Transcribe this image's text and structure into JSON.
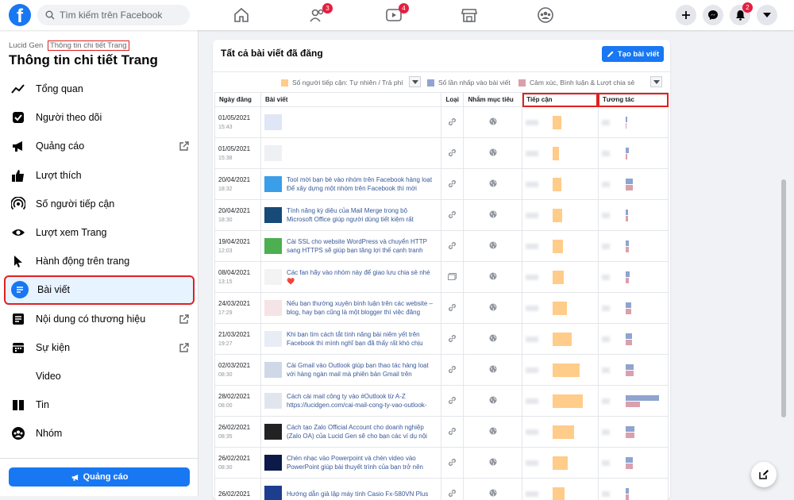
{
  "search": {
    "placeholder": "Tìm kiếm trên Facebook"
  },
  "nav": {
    "friends_badge": "3",
    "watch_badge": "4",
    "notif_badge": "2"
  },
  "sidebar": {
    "page_name": "Lucid Gen",
    "breadcrumb": "Thông tin chi tiết Trang",
    "title": "Thông tin chi tiết Trang",
    "items": [
      {
        "label": "Tổng quan"
      },
      {
        "label": "Người theo dõi"
      },
      {
        "label": "Quảng cáo"
      },
      {
        "label": "Lượt thích"
      },
      {
        "label": "Số người tiếp cận"
      },
      {
        "label": "Lượt xem Trang"
      },
      {
        "label": "Hành động trên trang"
      },
      {
        "label": "Bài viết"
      },
      {
        "label": "Nội dung có thương hiệu"
      },
      {
        "label": "Sự kiện"
      },
      {
        "label": "Video"
      },
      {
        "label": "Tin"
      },
      {
        "label": "Nhóm"
      }
    ],
    "ads_button": "Quảng cáo"
  },
  "main": {
    "title": "Tất cả bài viết đã đăng",
    "create_button": "Tạo bài viết",
    "legend": [
      {
        "label": "Số người tiếp cận: Tự nhiên / Trả phí",
        "color": "#ffcc8a"
      },
      {
        "label": "Số lần nhấp vào bài viết",
        "color": "#8fa4cf"
      },
      {
        "label": "Cảm xúc, Bình luận & Lượt chia sẻ",
        "color": "#d9a0ad"
      }
    ],
    "columns": [
      "Ngày đăng",
      "Bài viết",
      "Loại",
      "Nhắm mục tiêu",
      "Tiếp cận",
      "Tương tác"
    ],
    "rows": [
      {
        "date": "01/05/2021",
        "time": "15:43",
        "text": "",
        "type": "link",
        "reach": 0.28,
        "clicks": 0.04,
        "reactions": 0.0
      },
      {
        "date": "01/05/2021",
        "time": "15:38",
        "text": "",
        "type": "link",
        "reach": 0.2,
        "clicks": 0.1,
        "reactions": 0.04
      },
      {
        "date": "20/04/2021",
        "time": "18:32",
        "text": "Tool mời bạn bè vào nhóm trên Facebook hàng loạt Để xây dựng một nhóm trên Facebook thì mời",
        "type": "link",
        "reach": 0.3,
        "clicks": 0.22,
        "reactions": 0.22
      },
      {
        "date": "20/04/2021",
        "time": "18:30",
        "text": "Tính năng kỳ diệu của Mail Merge trong bộ Microsoft Office giúp người dùng tiết kiệm rất",
        "type": "link",
        "reach": 0.32,
        "clicks": 0.06,
        "reactions": 0.06
      },
      {
        "date": "19/04/2021",
        "time": "12:03",
        "text": "Cài SSL cho website WordPress và chuyển HTTP sang HTTPS sẽ giúp bạn tăng lợi thế cạnh tranh",
        "type": "link",
        "reach": 0.34,
        "clicks": 0.1,
        "reactions": 0.1
      },
      {
        "date": "08/04/2021",
        "time": "13:15",
        "text": "Các fan hãy vào nhóm này để giao lưu chia sẻ nhé ❤️",
        "type": "album",
        "reach": 0.36,
        "clicks": 0.12,
        "reactions": 0.1
      },
      {
        "date": "24/03/2021",
        "time": "17:29",
        "text": "Nếu bạn thường xuyên bình luận trên các website – blog, hay bạn cũng là một blogger thì việc đăng",
        "type": "link",
        "reach": 0.48,
        "clicks": 0.16,
        "reactions": 0.16
      },
      {
        "date": "21/03/2021",
        "time": "19:27",
        "text": "Khi bạn tìm cách tắt tính năng bài niêm yết trên Facebook thì mình nghĩ bạn đã thấy rất khó chịu",
        "type": "link",
        "reach": 0.62,
        "clicks": 0.2,
        "reactions": 0.2
      },
      {
        "date": "02/03/2021",
        "time": "08:30",
        "text": "Cài Gmail vào Outlook giúp bạn thao tác hàng loạt với hàng ngàn mail mà phiên bản Gmail trên",
        "type": "link",
        "reach": 0.9,
        "clicks": 0.24,
        "reactions": 0.24
      },
      {
        "date": "28/02/2021",
        "time": "08:00",
        "text": "Cách cài mail công ty vào #Outlook từ A-Z https://lucidgen.com/cai-mail-cong-ty-vao-outlook-",
        "type": "link",
        "reach": 1.0,
        "clicks": 1.0,
        "reactions": 0.42
      },
      {
        "date": "26/02/2021",
        "time": "08:35",
        "text": "Cách tạo Zalo Official Account cho doanh nghiệp (Zalo OA) của Lucid Gen sẽ cho bạn các ví dụ nội",
        "type": "link",
        "reach": 0.72,
        "clicks": 0.26,
        "reactions": 0.26
      },
      {
        "date": "26/02/2021",
        "time": "08:30",
        "text": "Chèn nhạc vào Powerpoint và chèn video vào PowerPoint giúp bài thuyết trình của bạn trở nên",
        "type": "link",
        "reach": 0.5,
        "clicks": 0.22,
        "reactions": 0.22
      },
      {
        "date": "26/02/2021",
        "time": "",
        "text": "Hướng dẫn giả lập máy tính Casio Fx-580VN Plus",
        "type": "link",
        "reach": 0.4,
        "clicks": 0.1,
        "reactions": 0.1
      }
    ]
  }
}
